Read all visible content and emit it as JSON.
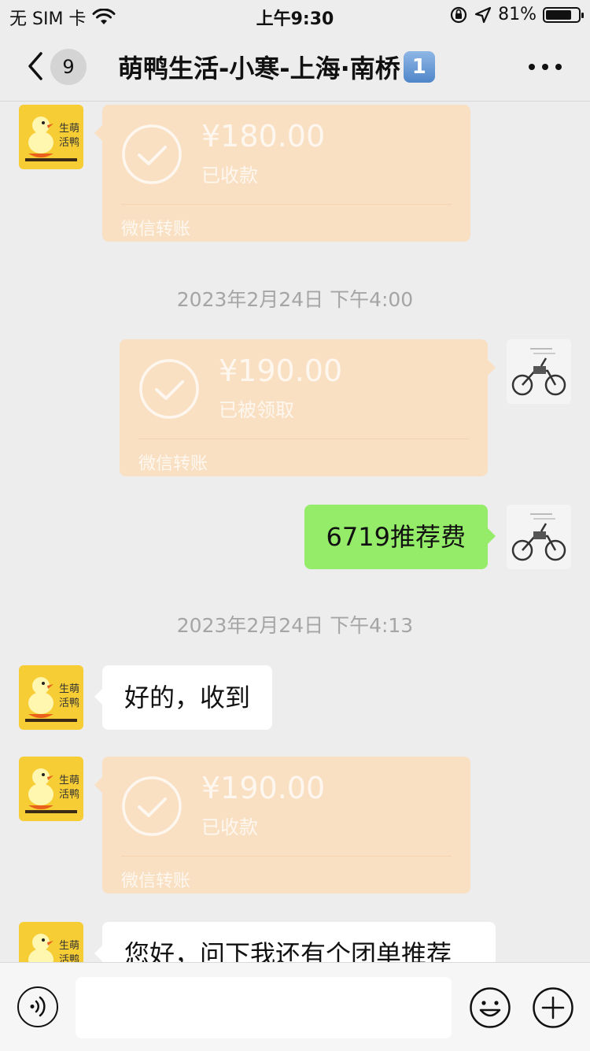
{
  "status_bar": {
    "carrier": "无 SIM 卡",
    "time": "上午9:30",
    "battery": "81%",
    "battery_level": 0.81
  },
  "nav": {
    "unread_count": "9",
    "title": "萌鸭生活-小寒-上海·南桥",
    "title_badge": "1"
  },
  "messages": {
    "transfer1": {
      "amount": "¥180.00",
      "status": "已收款",
      "label": "微信转账"
    },
    "timestamp1": "2023年2月24日 下午4:00",
    "transfer2": {
      "amount": "¥190.00",
      "status": "已被领取",
      "label": "微信转账"
    },
    "sent_text": "6719推荐费",
    "timestamp2": "2023年2月24日 下午4:13",
    "reply_text": "好的，收到",
    "transfer3": {
      "amount": "¥190.00",
      "status": "已收款",
      "label": "微信转账"
    },
    "partial_text": "您好，问下我还有个团单推荐"
  },
  "avatar": {
    "duck_line1": "生萌",
    "duck_line2": "活鸭"
  },
  "input": {
    "placeholder": ""
  },
  "colors": {
    "background": "#ededed",
    "transfer_bubble": "#fae0c3",
    "sent_bubble": "#95ec69",
    "received_bubble": "#ffffff",
    "timestamp": "#a5a5a5"
  }
}
